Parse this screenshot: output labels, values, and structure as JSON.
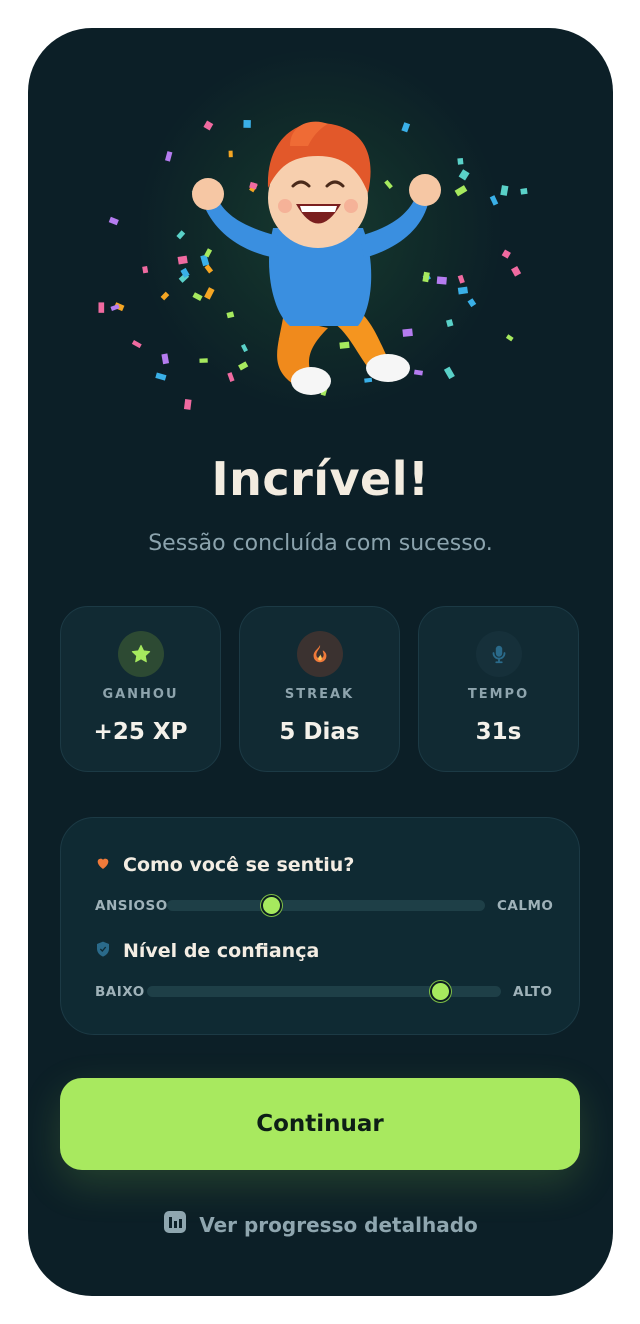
{
  "hero": {
    "illustration": "celebrating-boy-with-confetti"
  },
  "title": "Incrível!",
  "subtitle": "Sessão concluída com sucesso.",
  "stats": [
    {
      "icon": "star-icon",
      "label": "GANHOU",
      "value": "+25 XP",
      "color": "#a6e95e"
    },
    {
      "icon": "flame-icon",
      "label": "STREAK",
      "value": "5 Dias",
      "color": "#f07a3a"
    },
    {
      "icon": "microphone-icon",
      "label": "TEMPO",
      "value": "31s",
      "color": "#2a6a8a"
    }
  ],
  "mood": {
    "feeling": {
      "icon": "heart-icon",
      "question": "Como você se sentiu?",
      "min_label": "ANSIOSO",
      "max_label": "CALMO",
      "value_percent": 33
    },
    "confidence": {
      "icon": "shield-icon",
      "question": "Nível de confiança",
      "min_label": "BAIXO",
      "max_label": "ALTO",
      "value_percent": 83
    }
  },
  "continue_label": "Continuar",
  "progress_link": {
    "icon": "bar-chart-icon",
    "label": "Ver progresso detalhado"
  },
  "colors": {
    "background": "#0c1f27",
    "accent": "#a8e95f",
    "card": "#112a33"
  }
}
